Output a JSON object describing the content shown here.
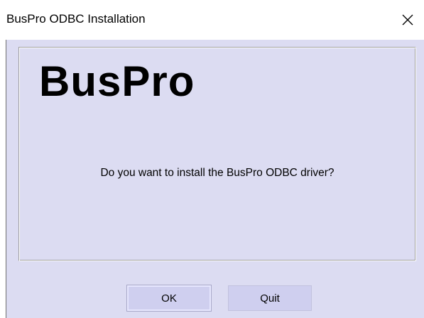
{
  "window": {
    "title": "BusPro ODBC Installation",
    "close_glyph": "✕"
  },
  "content": {
    "brand": "BusPro",
    "question": "Do you want to install the BusPro ODBC driver?"
  },
  "buttons": {
    "ok_label": "OK",
    "quit_label": "Quit"
  },
  "colors": {
    "client_background": "#dcdcf2",
    "button_background": "#cfcfef"
  }
}
